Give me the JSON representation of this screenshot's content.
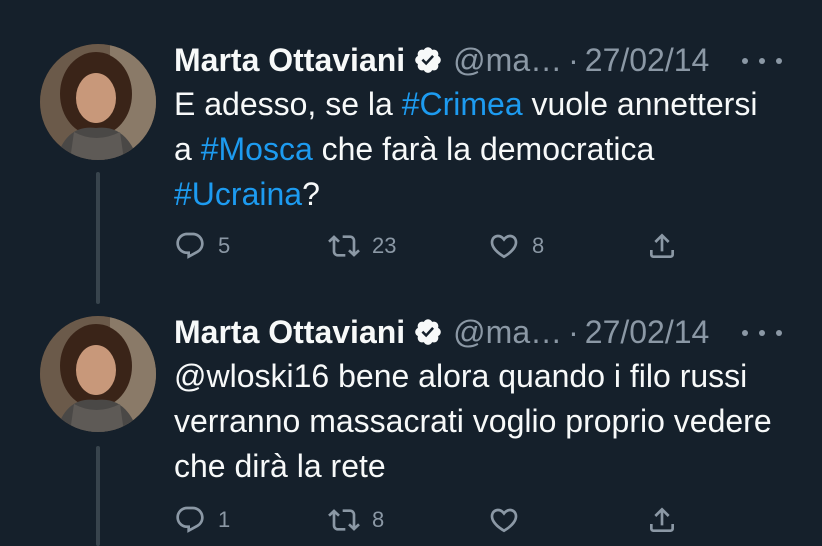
{
  "tweets": [
    {
      "author": "Marta Ottaviani",
      "handle": "@ma…",
      "separator": "·",
      "date": "27/02/14",
      "text_parts": [
        "E adesso, se la ",
        "#Crimea",
        " vuole annettersi a ",
        "#Mosca",
        " che farà la democratica ",
        "#Ucraina",
        "?"
      ],
      "reply_count": "5",
      "retweet_count": "23",
      "like_count": "8"
    },
    {
      "author": "Marta Ottaviani",
      "handle": "@ma…",
      "separator": "·",
      "date": "27/02/14",
      "text": "@wloski16 bene alora quando i filo russi verranno massacrati voglio proprio vedere che dirà la rete",
      "reply_count": "1",
      "retweet_count": "8",
      "like_count": ""
    }
  ],
  "icons": {
    "verified": "verified-badge-icon",
    "more": "more-icon",
    "reply": "reply-icon",
    "retweet": "retweet-icon",
    "like": "heart-icon",
    "share": "share-icon"
  },
  "colors": {
    "background": "#15202b",
    "text": "#f7f9f9",
    "secondary": "#8b98a5",
    "link": "#1d9bf0",
    "thread_line": "#38444d"
  }
}
